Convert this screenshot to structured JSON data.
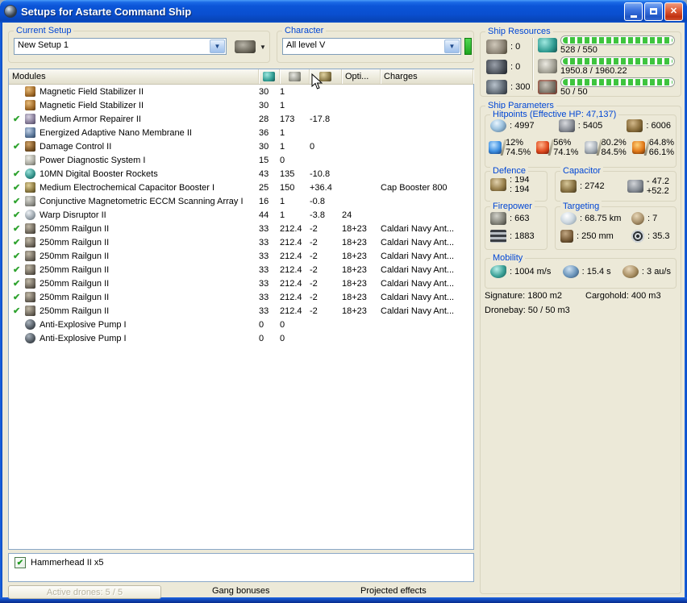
{
  "colors": {
    "titlebar_blue": "#0b55d8",
    "groupbox_caption_blue": "#0046D5",
    "active_check_green": "#2fa32f",
    "resource_bar_green": "#3ec43e",
    "character_status_green": "#2fc52f",
    "close_button_red": "#c03011"
  },
  "window": {
    "title": "Setups for Astarte Command Ship"
  },
  "toolbar": {
    "current_setup_label": "Current Setup",
    "current_setup_value": "New Setup 1",
    "character_label": "Character",
    "character_value": "All level V"
  },
  "modules_table": {
    "headers": {
      "modules": "Modules",
      "cpu_icon": "cpu",
      "powergrid_icon": "powergrid",
      "capacitor_icon": "capacitor",
      "opti": "Opti...",
      "charges": "Charges"
    },
    "rows": [
      {
        "active": false,
        "icon": "mfs",
        "name": "Magnetic Field Stabilizer II",
        "cpu": "30",
        "pg": "1",
        "cap": "",
        "opti": "",
        "charges": ""
      },
      {
        "active": false,
        "icon": "mfs",
        "name": "Magnetic Field Stabilizer II",
        "cpu": "30",
        "pg": "1",
        "cap": "",
        "opti": "",
        "charges": ""
      },
      {
        "active": true,
        "icon": "repairer",
        "name": "Medium Armor Repairer II",
        "cpu": "28",
        "pg": "173",
        "cap": "-17.8",
        "opti": "",
        "charges": ""
      },
      {
        "active": false,
        "icon": "eanm",
        "name": "Energized Adaptive Nano Membrane II",
        "cpu": "36",
        "pg": "1",
        "cap": "",
        "opti": "",
        "charges": ""
      },
      {
        "active": true,
        "icon": "dcu",
        "name": "Damage Control II",
        "cpu": "30",
        "pg": "1",
        "cap": "0",
        "opti": "",
        "charges": ""
      },
      {
        "active": false,
        "icon": "pds",
        "name": "Power Diagnostic System I",
        "cpu": "15",
        "pg": "0",
        "cap": "",
        "opti": "",
        "charges": ""
      },
      {
        "active": true,
        "icon": "booster",
        "name": "10MN Digital Booster Rockets",
        "cpu": "43",
        "pg": "135",
        "cap": "-10.8",
        "opti": "",
        "charges": ""
      },
      {
        "active": true,
        "icon": "capbooster",
        "name": "Medium Electrochemical Capacitor Booster I",
        "cpu": "25",
        "pg": "150",
        "cap": "+36.4",
        "opti": "",
        "charges": "Cap Booster 800"
      },
      {
        "active": true,
        "icon": "eccm",
        "name": "Conjunctive Magnetometric ECCM Scanning Array I",
        "cpu": "16",
        "pg": "1",
        "cap": "-0.8",
        "opti": "",
        "charges": ""
      },
      {
        "active": true,
        "icon": "disruptor",
        "name": "Warp Disruptor II",
        "cpu": "44",
        "pg": "1",
        "cap": "-3.8",
        "opti": "24",
        "charges": ""
      },
      {
        "active": true,
        "icon": "railgun",
        "name": "250mm Railgun II",
        "cpu": "33",
        "pg": "212.4",
        "cap": "-2",
        "opti": "18+23",
        "charges": "Caldari Navy Ant..."
      },
      {
        "active": true,
        "icon": "railgun",
        "name": "250mm Railgun II",
        "cpu": "33",
        "pg": "212.4",
        "cap": "-2",
        "opti": "18+23",
        "charges": "Caldari Navy Ant..."
      },
      {
        "active": true,
        "icon": "railgun",
        "name": "250mm Railgun II",
        "cpu": "33",
        "pg": "212.4",
        "cap": "-2",
        "opti": "18+23",
        "charges": "Caldari Navy Ant..."
      },
      {
        "active": true,
        "icon": "railgun",
        "name": "250mm Railgun II",
        "cpu": "33",
        "pg": "212.4",
        "cap": "-2",
        "opti": "18+23",
        "charges": "Caldari Navy Ant..."
      },
      {
        "active": true,
        "icon": "railgun",
        "name": "250mm Railgun II",
        "cpu": "33",
        "pg": "212.4",
        "cap": "-2",
        "opti": "18+23",
        "charges": "Caldari Navy Ant..."
      },
      {
        "active": true,
        "icon": "railgun",
        "name": "250mm Railgun II",
        "cpu": "33",
        "pg": "212.4",
        "cap": "-2",
        "opti": "18+23",
        "charges": "Caldari Navy Ant..."
      },
      {
        "active": true,
        "icon": "railgun",
        "name": "250mm Railgun II",
        "cpu": "33",
        "pg": "212.4",
        "cap": "-2",
        "opti": "18+23",
        "charges": "Caldari Navy Ant..."
      },
      {
        "active": false,
        "icon": "pump",
        "name": "Anti-Explosive Pump I",
        "cpu": "0",
        "pg": "0",
        "cap": "",
        "opti": "",
        "charges": ""
      },
      {
        "active": false,
        "icon": "pump",
        "name": "Anti-Explosive Pump I",
        "cpu": "0",
        "pg": "0",
        "cap": "",
        "opti": "",
        "charges": ""
      }
    ]
  },
  "drones_panel": {
    "items": [
      {
        "checked": true,
        "label": "Hammerhead II x5"
      }
    ]
  },
  "footer": {
    "active_drones": "Active drones: 5 / 5",
    "gang_bonuses": "Gang bonuses",
    "projected_effects": "Projected effects"
  },
  "ship_resources": {
    "title": "Ship Resources",
    "turret_hardpoints": ": 0",
    "launcher_hardpoints": ": 0",
    "upgrade_capacity": ": 300",
    "cpu": "528 / 550",
    "powergrid": "1950.8 / 1960.22",
    "calibration": "50 / 50"
  },
  "ship_parameters": {
    "title": "Ship Parameters",
    "hitpoints": {
      "title": "Hitpoints (Effective HP: 47,137)",
      "shield": ": 4997",
      "armor": ": 5405",
      "structure": ": 6006",
      "resists": [
        {
          "type": "em",
          "shield": "12%",
          "armor": "74.5%"
        },
        {
          "type": "thermal",
          "shield": "56%",
          "armor": "74.1%"
        },
        {
          "type": "kinetic",
          "shield": "80.2%",
          "armor": "84.5%"
        },
        {
          "type": "explosive",
          "shield": "64.8%",
          "armor": "66.1%"
        }
      ]
    },
    "defence": {
      "title": "Defence",
      "line1": ": 194",
      "line2": ": 194"
    },
    "capacitor": {
      "title": "Capacitor",
      "amount": ": 2742",
      "drain": "- 47.2",
      "recharge": "+52.2"
    },
    "firepower": {
      "title": "Firepower",
      "dps": ": 663",
      "volley": ": 1883"
    },
    "targeting": {
      "title": "Targeting",
      "range": ": 68.75 km",
      "max_targets": ": 7",
      "signature_resolution": ": 250 mm",
      "scan_resolution": ": 35.3"
    },
    "mobility": {
      "title": "Mobility",
      "speed": ": 1004 m/s",
      "agility": ": 15.4 s",
      "warp_speed": ": 3 au/s"
    },
    "signature": "Signature: 1800 m2",
    "cargohold": "Cargohold: 400 m3",
    "dronebay": "Dronebay: 50 / 50 m3"
  }
}
